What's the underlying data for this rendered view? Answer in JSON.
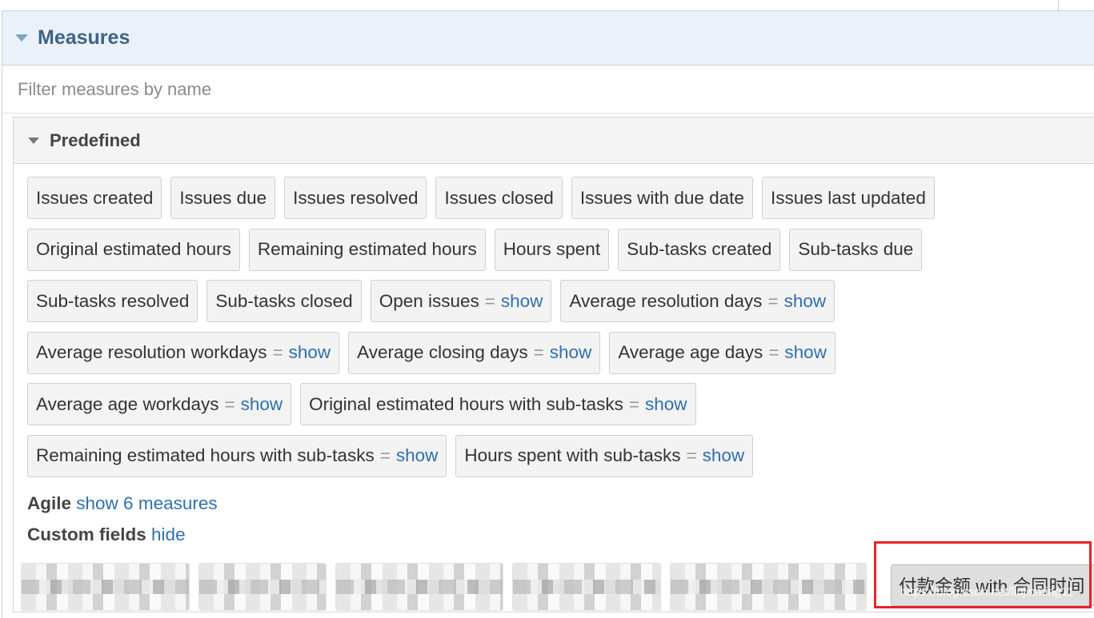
{
  "measures_panel": {
    "title": "Measures",
    "filter_placeholder": "Filter measures by name"
  },
  "predefined": {
    "title": "Predefined",
    "rows": [
      [
        {
          "label": "Issues created"
        },
        {
          "label": "Issues due"
        },
        {
          "label": "Issues resolved"
        },
        {
          "label": "Issues closed"
        },
        {
          "label": "Issues with due date"
        },
        {
          "label": "Issues last updated"
        }
      ],
      [
        {
          "label": "Original estimated hours"
        },
        {
          "label": "Remaining estimated hours"
        },
        {
          "label": "Hours spent"
        },
        {
          "label": "Sub-tasks created"
        },
        {
          "label": "Sub-tasks due"
        }
      ],
      [
        {
          "label": "Sub-tasks resolved"
        },
        {
          "label": "Sub-tasks closed"
        },
        {
          "label": "Open issues",
          "eq": "=",
          "show": "show"
        },
        {
          "label": "Average resolution days",
          "eq": "=",
          "show": "show"
        }
      ],
      [
        {
          "label": "Average resolution workdays",
          "eq": "=",
          "show": "show"
        },
        {
          "label": "Average closing days",
          "eq": "=",
          "show": "show"
        },
        {
          "label": "Average age days",
          "eq": "=",
          "show": "show"
        }
      ],
      [
        {
          "label": "Average age workdays",
          "eq": "=",
          "show": "show"
        },
        {
          "label": "Original estimated hours with sub-tasks",
          "eq": "=",
          "show": "show"
        }
      ],
      [
        {
          "label": "Remaining estimated hours with sub-tasks",
          "eq": "=",
          "show": "show"
        },
        {
          "label": "Hours spent with sub-tasks",
          "eq": "=",
          "show": "show"
        }
      ]
    ]
  },
  "agile": {
    "label": "Agile",
    "link": "show 6 measures"
  },
  "custom_fields": {
    "label": "Custom fields",
    "link": "hide",
    "highlighted_chip": "付款金额 with 合同时间",
    "watermark": "https://blog.csdn.net/liujinming11"
  },
  "colors": {
    "link": "#2f6fb1",
    "header_bg": "#eaf1f9",
    "title": "#3f6384",
    "highlight_box": "#e6232b"
  }
}
